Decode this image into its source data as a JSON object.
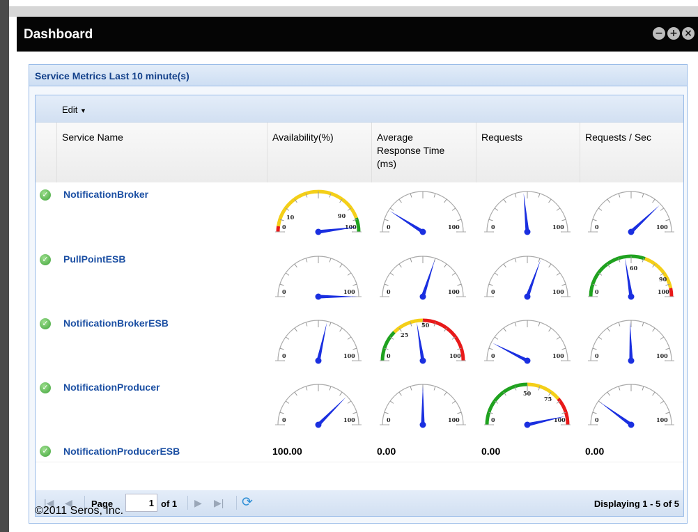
{
  "window": {
    "title": "Dashboard",
    "buttons": [
      "−",
      "+",
      "×"
    ]
  },
  "panel": {
    "title": "Service Metrics Last 10 minute(s)"
  },
  "toolbar": {
    "edit_label": "Edit",
    "edit_arrow": "▼"
  },
  "columns": {
    "service_name": "Service Name",
    "availability": "Availability(%)",
    "response_line1": "Average",
    "response_line2": "Response Time",
    "response_line3": "(ms)",
    "requests": "Requests",
    "requests_sec": "Requests / Sec"
  },
  "rows": [
    {
      "status_icon": "check-circle-icon",
      "name": "NotificationBroker",
      "gauges": [
        {
          "type": "colored",
          "fraction": 0.96,
          "labels": [
            "0",
            "10",
            "90",
            "100"
          ]
        },
        {
          "type": "plain",
          "fraction": 0.18,
          "labels": [
            "0",
            "100"
          ]
        },
        {
          "type": "plain",
          "fraction": 0.47,
          "labels": [
            "0",
            "100"
          ]
        },
        {
          "type": "plain",
          "fraction": 0.76,
          "labels": [
            "0",
            "100"
          ]
        }
      ]
    },
    {
      "status_icon": "check-circle-icon",
      "name": "PullPointESB",
      "gauges": [
        {
          "type": "plain",
          "fraction": 1.0,
          "labels": [
            "0",
            "100"
          ]
        },
        {
          "type": "plain",
          "fraction": 0.6,
          "labels": [
            "0",
            "100"
          ]
        },
        {
          "type": "plain",
          "fraction": 0.61,
          "labels": [
            "0",
            "100"
          ]
        },
        {
          "type": "colored2",
          "fraction": 0.45,
          "labels": [
            "0",
            "60",
            "90",
            "100"
          ]
        }
      ]
    },
    {
      "status_icon": "check-circle-icon",
      "name": "NotificationBrokerESB",
      "gauges": [
        {
          "type": "plain",
          "fraction": 0.57,
          "labels": [
            "0",
            "100"
          ]
        },
        {
          "type": "colored3",
          "fraction": 0.45,
          "labels": [
            "0",
            "25",
            "50",
            "100"
          ]
        },
        {
          "type": "plain",
          "fraction": 0.15,
          "labels": [
            "0",
            "100"
          ]
        },
        {
          "type": "plain",
          "fraction": 0.49,
          "labels": [
            "0",
            "100"
          ]
        }
      ]
    },
    {
      "status_icon": "check-circle-icon",
      "name": "NotificationProducer",
      "gauges": [
        {
          "type": "plain",
          "fraction": 0.75,
          "labels": [
            "0",
            "100"
          ]
        },
        {
          "type": "plain",
          "fraction": 0.5,
          "labels": [
            "0",
            "100"
          ]
        },
        {
          "type": "colored4",
          "fraction": 0.93,
          "labels": [
            "0",
            "50",
            "75",
            "100"
          ]
        },
        {
          "type": "plain",
          "fraction": 0.2,
          "labels": [
            "0",
            "100"
          ]
        }
      ]
    },
    {
      "status_icon": "check-circle-icon",
      "name": "NotificationProducerESB",
      "values": [
        "100.00",
        "0.00",
        "0.00",
        "0.00"
      ]
    }
  ],
  "pager": {
    "first_icon": "first-page-icon",
    "prev_icon": "prev-page-icon",
    "page_label": "Page",
    "page_value": "1",
    "of_label": "of 1",
    "next_icon": "next-page-icon",
    "last_icon": "last-page-icon",
    "refresh_icon": "refresh-icon",
    "display_text": "Displaying 1 - 5 of 5"
  },
  "footer": {
    "copyright": "©2011 Seros, Inc."
  },
  "colors": {
    "title_bar": "#050505",
    "link": "#1b4fa3",
    "needle": "#1a2fe0",
    "gauge_green": "#1fa21f",
    "gauge_yellow": "#f4cf18",
    "gauge_red": "#e81919"
  }
}
